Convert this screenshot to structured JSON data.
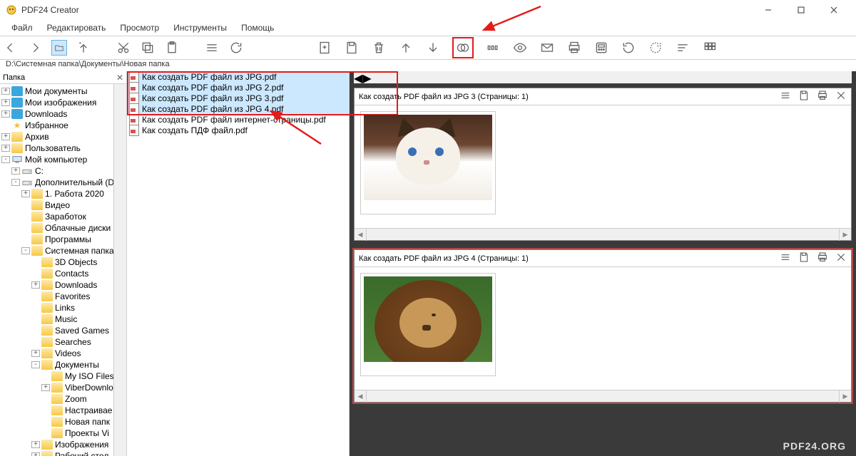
{
  "window": {
    "title": "PDF24 Creator"
  },
  "menu": {
    "file": "Файл",
    "edit": "Редактировать",
    "view": "Просмотр",
    "tools": "Инструменты",
    "help": "Помощь"
  },
  "path": "D:\\Системная папка\\Документы\\Новая папка",
  "treehead": "Папка",
  "tree": [
    {
      "pad": 0,
      "twig": "+",
      "ic": "blue",
      "label": "Мои документы"
    },
    {
      "pad": 0,
      "twig": "+",
      "ic": "blue",
      "label": "Мои изображения"
    },
    {
      "pad": 0,
      "twig": "+",
      "ic": "blue",
      "label": "Downloads"
    },
    {
      "pad": 0,
      "twig": "",
      "ic": "star",
      "label": "Избранное"
    },
    {
      "pad": 0,
      "twig": "+",
      "ic": "folder",
      "label": "Архив"
    },
    {
      "pad": 0,
      "twig": "+",
      "ic": "folder",
      "label": "Пользователь"
    },
    {
      "pad": 0,
      "twig": "-",
      "ic": "drive",
      "label": "Мой компьютер"
    },
    {
      "pad": 1,
      "twig": "+",
      "ic": "drive2",
      "label": "C:"
    },
    {
      "pad": 1,
      "twig": "-",
      "ic": "drive2",
      "label": "Дополнительный (D:"
    },
    {
      "pad": 2,
      "twig": "+",
      "ic": "folder",
      "label": "1. Работа 2020"
    },
    {
      "pad": 2,
      "twig": "",
      "ic": "folder",
      "label": "Видео"
    },
    {
      "pad": 2,
      "twig": "",
      "ic": "folder",
      "label": "Заработок"
    },
    {
      "pad": 2,
      "twig": "",
      "ic": "folder",
      "label": "Облачные диски"
    },
    {
      "pad": 2,
      "twig": "",
      "ic": "folder",
      "label": "Программы"
    },
    {
      "pad": 2,
      "twig": "-",
      "ic": "folder",
      "label": "Системная папка"
    },
    {
      "pad": 3,
      "twig": "",
      "ic": "folder",
      "label": "3D Objects"
    },
    {
      "pad": 3,
      "twig": "",
      "ic": "folder",
      "label": "Contacts"
    },
    {
      "pad": 3,
      "twig": "+",
      "ic": "folder",
      "label": "Downloads"
    },
    {
      "pad": 3,
      "twig": "",
      "ic": "folder",
      "label": "Favorites"
    },
    {
      "pad": 3,
      "twig": "",
      "ic": "folder",
      "label": "Links"
    },
    {
      "pad": 3,
      "twig": "",
      "ic": "folder",
      "label": "Music"
    },
    {
      "pad": 3,
      "twig": "",
      "ic": "folder",
      "label": "Saved Games"
    },
    {
      "pad": 3,
      "twig": "",
      "ic": "folder",
      "label": "Searches"
    },
    {
      "pad": 3,
      "twig": "+",
      "ic": "folder",
      "label": "Videos"
    },
    {
      "pad": 3,
      "twig": "-",
      "ic": "folder",
      "label": "Документы"
    },
    {
      "pad": 4,
      "twig": "",
      "ic": "folder",
      "label": "My ISO Files"
    },
    {
      "pad": 4,
      "twig": "+",
      "ic": "folder",
      "label": "ViberDownlo"
    },
    {
      "pad": 4,
      "twig": "",
      "ic": "folder",
      "label": "Zoom"
    },
    {
      "pad": 4,
      "twig": "",
      "ic": "folder",
      "label": "Настраивае"
    },
    {
      "pad": 4,
      "twig": "",
      "ic": "folder",
      "label": "Новая папк"
    },
    {
      "pad": 4,
      "twig": "",
      "ic": "folder",
      "label": "Проекты Vi"
    },
    {
      "pad": 3,
      "twig": "+",
      "ic": "folder",
      "label": "Изображения"
    },
    {
      "pad": 3,
      "twig": "+",
      "ic": "folder",
      "label": "Рабочий стол"
    }
  ],
  "files": [
    {
      "sel": true,
      "label": "Как создать PDF файл из JPG.pdf"
    },
    {
      "sel": true,
      "label": "Как создать PDF файл из JPG 2.pdf"
    },
    {
      "sel": true,
      "label": "Как создать PDF файл из JPG 3.pdf"
    },
    {
      "sel": true,
      "label": "Как создать PDF файл из JPG 4.pdf"
    },
    {
      "sel": false,
      "label": "Как создать PDF файл интернет-страницы.pdf"
    },
    {
      "sel": false,
      "label": "Как создать ПДФ файл.pdf"
    }
  ],
  "docs": [
    {
      "title": "Как создать PDF файл из JPG 3 (Страницы: 1)",
      "img": "cat",
      "sel": false
    },
    {
      "title": "Как создать PDF файл из JPG 4 (Страницы: 1)",
      "img": "lion",
      "sel": true
    }
  ],
  "watermark": "PDF24.ORG"
}
